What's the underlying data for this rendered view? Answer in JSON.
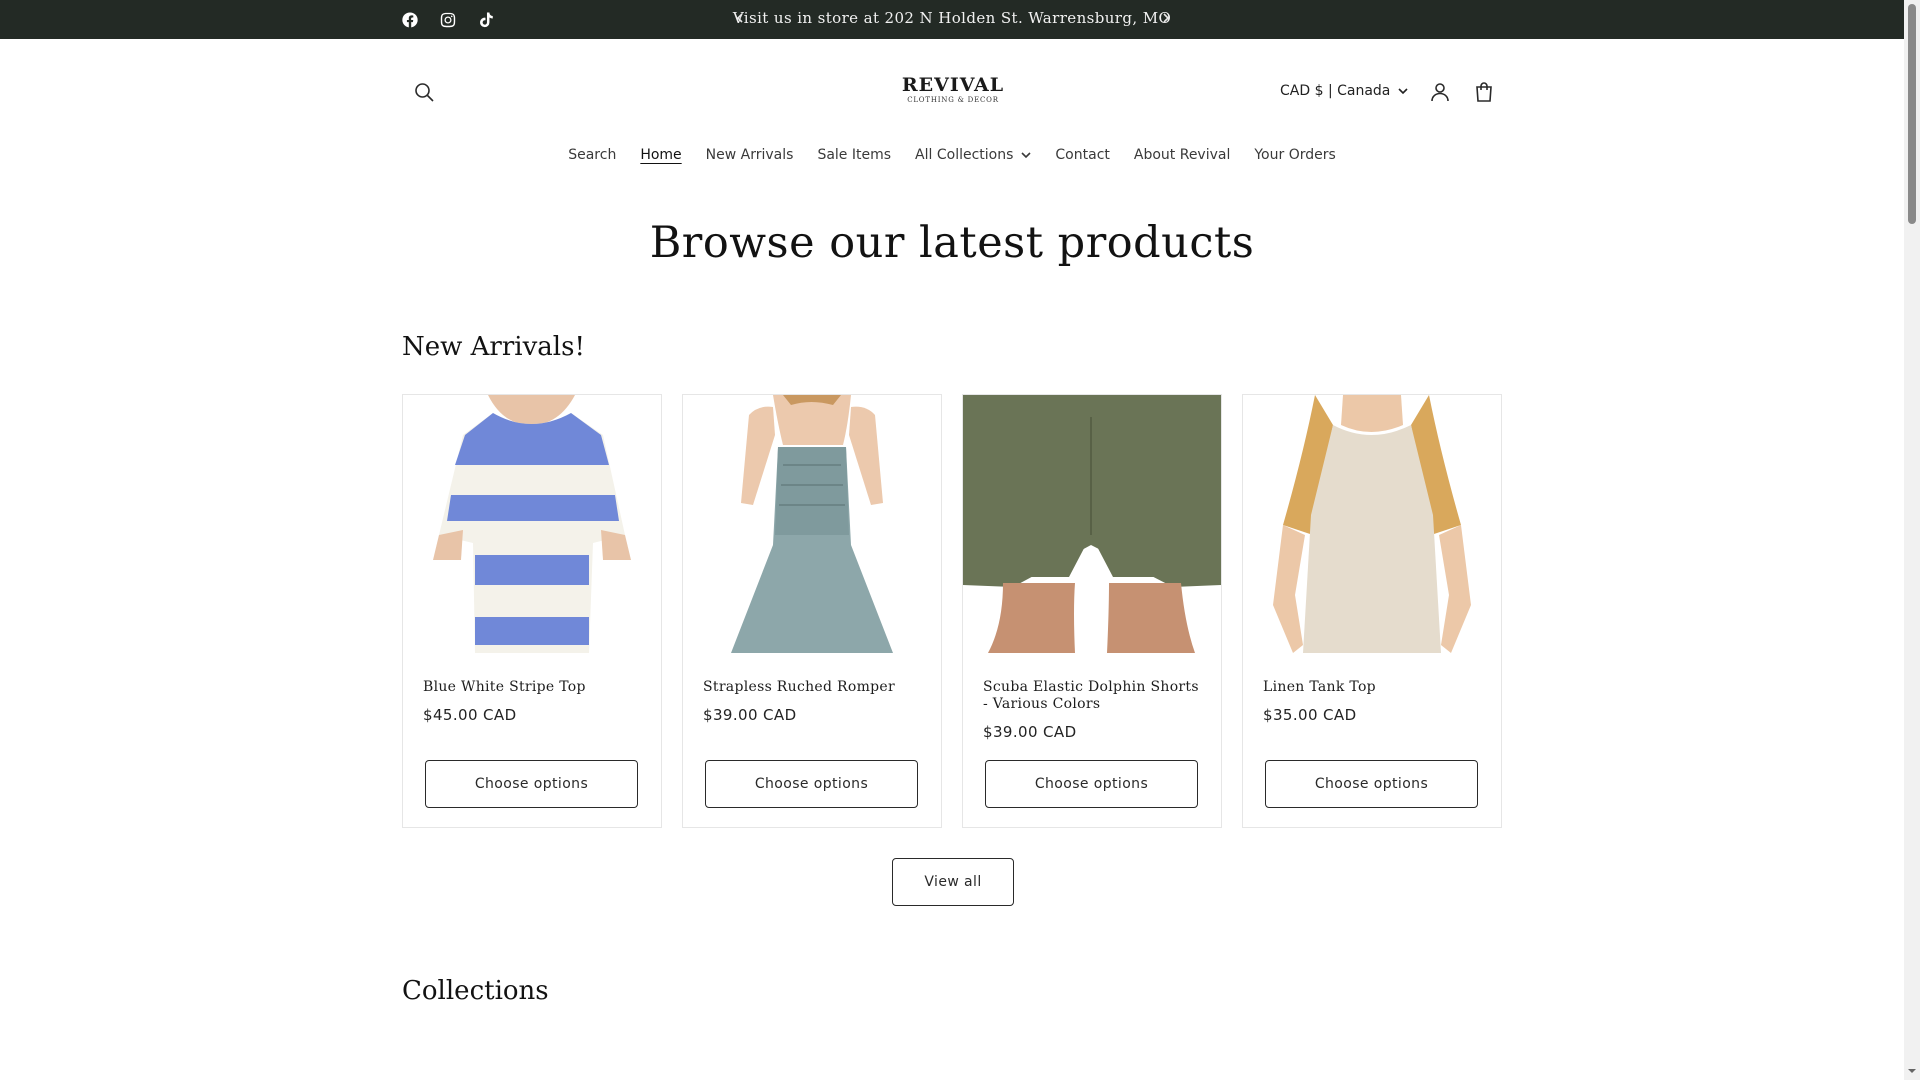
{
  "announcement": {
    "text": "Visit us in store at 202 N Holden St. Warrensburg, MO",
    "prev_icon": "chevron-left-icon",
    "next_icon": "chevron-right-icon",
    "background": "#232a25"
  },
  "social": [
    {
      "name": "facebook-icon"
    },
    {
      "name": "instagram-icon"
    },
    {
      "name": "tiktok-icon"
    }
  ],
  "header": {
    "logo": {
      "line1": "REVIVAL",
      "line2": "CLOTHING & DECOR"
    },
    "currency": "CAD $ | Canada",
    "icons": [
      "search-icon",
      "account-icon",
      "cart-icon"
    ]
  },
  "nav": [
    {
      "label": "Search"
    },
    {
      "label": "Home",
      "active": true
    },
    {
      "label": "New Arrivals"
    },
    {
      "label": "Sale Items"
    },
    {
      "label": "All Collections",
      "has_dropdown": true
    },
    {
      "label": "Contact"
    },
    {
      "label": "About Revival"
    },
    {
      "label": "Your Orders"
    }
  ],
  "main": {
    "title": "Browse our latest products",
    "new_arrivals_heading": "New Arrivals!",
    "collections_heading": "Collections",
    "view_all_label": "View all"
  },
  "products": [
    {
      "title": "Blue White Stripe Top",
      "price": "$45.00 CAD",
      "button": "Choose options"
    },
    {
      "title": "Strapless Ruched Romper",
      "price": "$39.00 CAD",
      "button": "Choose options"
    },
    {
      "title": "Scuba Elastic Dolphin Shorts - Various Colors",
      "price": "$39.00 CAD",
      "button": "Choose options"
    },
    {
      "title": "Linen Tank Top",
      "price": "$35.00 CAD",
      "button": "Choose options"
    }
  ]
}
